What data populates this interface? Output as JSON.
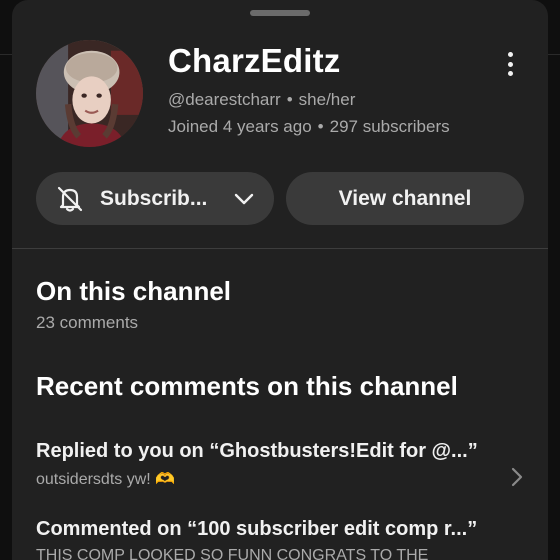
{
  "channel": {
    "name": "CharzEditz",
    "handle": "@dearestcharr",
    "pronouns": "she/her",
    "joined": "Joined 4 years ago",
    "subscribers": "297 subscribers"
  },
  "actions": {
    "subscribe_label": "Subscrib...",
    "view_channel_label": "View channel"
  },
  "on_channel": {
    "title": "On this channel",
    "count": "23 comments"
  },
  "recent": {
    "title": "Recent comments on this channel",
    "items": [
      {
        "headline": "Replied to you on “Ghostbusters!Edit for @...”",
        "snippet": "outsidersdts yw! 🫶"
      },
      {
        "headline": "Commented on “100 subscriber edit comp r...”",
        "snippet": "THIS COMP LOOKED SO FUNN CONGRATS TO THE"
      }
    ]
  },
  "icons": {
    "more": "more-vertical-icon",
    "bell": "bell-off-icon",
    "chevron": "chevron-down-icon",
    "arrow": "chevron-right-icon"
  },
  "colors": {
    "sheet": "#212121",
    "button": "#3a3a3a",
    "text_primary": "#f1f1f1",
    "text_secondary": "#aaaaaa"
  }
}
